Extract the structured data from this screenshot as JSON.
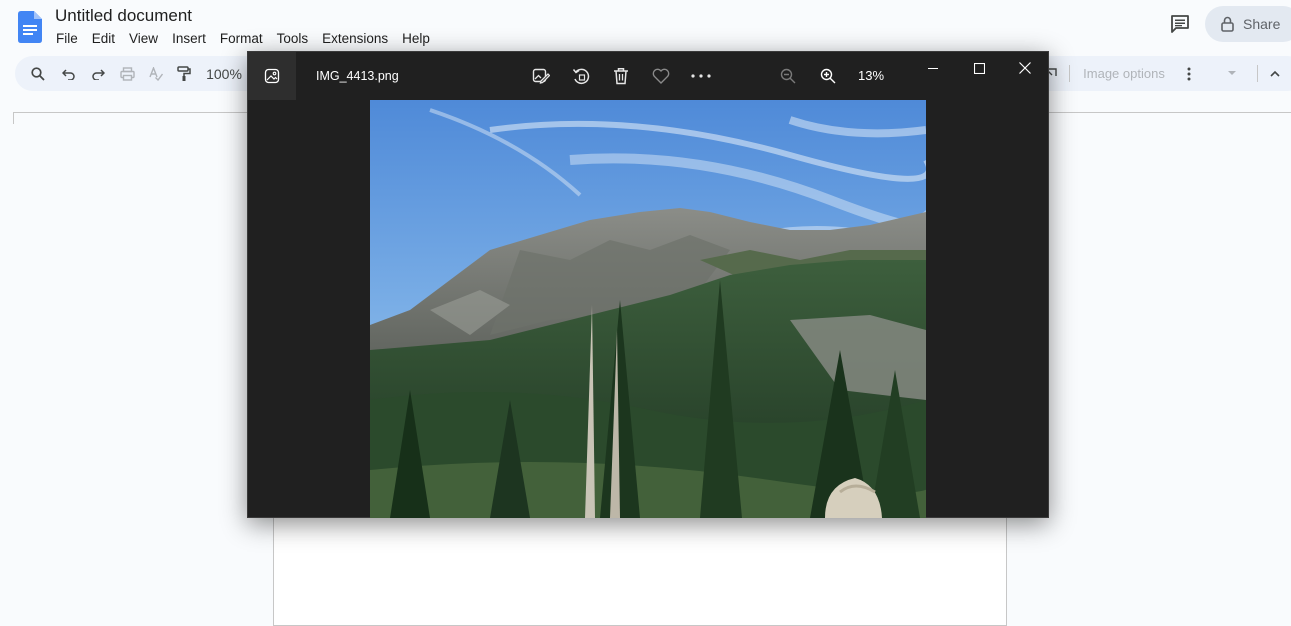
{
  "docs": {
    "title": "Untitled document",
    "menu": [
      "File",
      "Edit",
      "View",
      "Insert",
      "Format",
      "Tools",
      "Extensions",
      "Help"
    ],
    "share_label": "Share",
    "toolbar": {
      "zoom": "100%",
      "image_options_label": "Image options"
    },
    "icons": {
      "logo": "google-docs-logo",
      "comment": "comment-history-icon",
      "share_lock": "lock-icon"
    }
  },
  "viewer": {
    "filename": "IMG_4413.png",
    "zoom_level": "13%",
    "toolbar_icons": [
      "edit-image-icon",
      "rotate-icon",
      "delete-icon",
      "favorite-icon",
      "more-icon"
    ],
    "zoom_icons": [
      "zoom-out-icon",
      "zoom-in-icon"
    ],
    "window_controls": [
      "minimize-icon",
      "maximize-icon",
      "close-icon"
    ]
  },
  "colors": {
    "docs_blue": "#4285f4",
    "viewer_bg": "#202020",
    "toolbar_bg": "#edf2fa"
  }
}
